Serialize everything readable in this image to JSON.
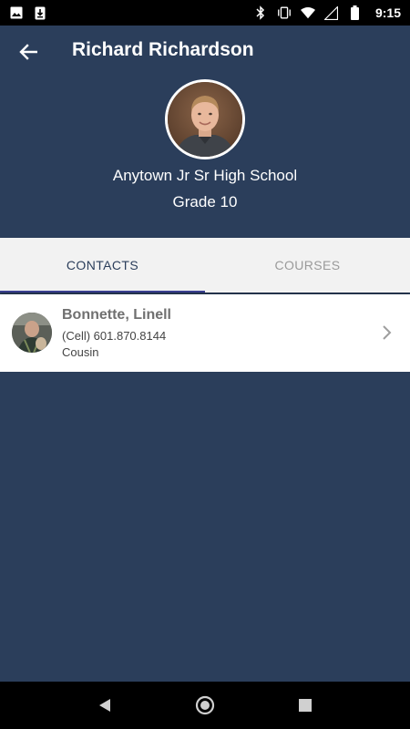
{
  "status_bar": {
    "time": "9:15",
    "left_icons": [
      "image-icon",
      "download-icon"
    ],
    "right_icons": [
      "bluetooth-icon",
      "vibrate-icon",
      "wifi-icon",
      "signal-icon",
      "battery-icon"
    ]
  },
  "header": {
    "title": "Richard Richardson",
    "school": "Anytown Jr Sr High School",
    "grade": "Grade 10"
  },
  "tabs": [
    {
      "label": "CONTACTS",
      "active": true
    },
    {
      "label": "COURSES",
      "active": false
    }
  ],
  "contacts": [
    {
      "name": "Bonnette, Linell",
      "phone": "(Cell) 601.870.8144",
      "relation": "Cousin"
    }
  ],
  "colors": {
    "header_bg": "#2b3e5b",
    "tab_indicator": "#3a3f8f"
  }
}
